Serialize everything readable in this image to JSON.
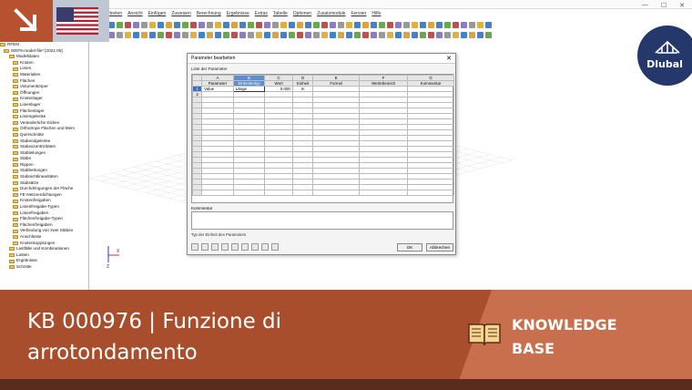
{
  "menu": [
    "Bearbeiten",
    "Ansicht",
    "Einfügen",
    "Zuweisen",
    "Berechnung",
    "Ergebnisse",
    "Extras",
    "Tabelle",
    "Optionen",
    "Zusatzmodule",
    "Fenster",
    "Hilfe"
  ],
  "window_controls": {
    "min": "—",
    "max": "☐",
    "close": "✕"
  },
  "navigator": {
    "items": [
      "RFEM",
      "00976-model-file* [2021-05]",
      "Modelldaten",
      "Knoten",
      "Linien",
      "Materialien",
      "Flächen",
      "Volumenkörper",
      "Öffnungen",
      "Knotenlager",
      "Linienlager",
      "Flächenlager",
      "Liniengelenke",
      "Veränderliche Dicken",
      "Orthotrope Flächen und Mem",
      "Querschnitte",
      "Stabendgelenke",
      "Stabexzentrizitäten",
      "Stabteilungen",
      "Stäbe",
      "Rippen",
      "Stabbettungen",
      "Stabnichtlinearitäten",
      "Stabsätze",
      "Durchdringungen der Fläche",
      "FE-Netzverdichtungen",
      "Knotenfreigaben",
      "Linienfreigabe-Typen",
      "Linienfreigaben",
      "Flächenfreigabe-Typen",
      "Flächenfreigaben",
      "Verbindung von zwei Stäben",
      "Anschlüsse",
      "Knotenkopplungen",
      "Lastfälle und Kombinationen",
      "Lasten",
      "Ergebnisse",
      "Schnitte"
    ]
  },
  "dialog": {
    "title": "Parameter bearbeiten",
    "close": "✕",
    "list_label": "Liste der Parameter",
    "col_letters": [
      "A",
      "B",
      "C",
      "D",
      "E",
      "F",
      "G"
    ],
    "col_names": [
      "Parameter",
      "Einheitentyp",
      "Wert",
      "Einheit",
      "Formel",
      "Wertebereich",
      "Kommentar"
    ],
    "rows": [
      {
        "no": "1",
        "cells": [
          "Value",
          "Länge",
          "0.000",
          "m",
          "",
          "",
          ""
        ]
      },
      {
        "no": "2",
        "cells": [
          "",
          "",
          "",
          "",
          "",
          "",
          ""
        ]
      }
    ],
    "comment_label": "Kommentar",
    "status": "Typ der Einheit des Parameters",
    "ok": "OK",
    "cancel": "Abbrechen"
  },
  "axis": {
    "x": "X",
    "z": "Z"
  },
  "brand": {
    "name": "Dlubal"
  },
  "banner": {
    "title": "KB 000976 | Funzione di arrotondamento",
    "badge_line1": "KNOWLEDGE",
    "badge_line2": "BASE"
  },
  "colors": {
    "banner": "#a94e2d",
    "banner_light": "#c8704e",
    "brand_circle": "#24386b",
    "arrow_box": "#b6522f"
  }
}
